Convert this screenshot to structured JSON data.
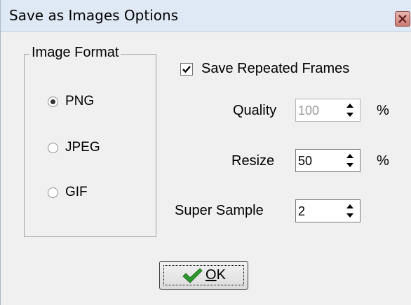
{
  "window": {
    "title": "Save as Images Options"
  },
  "image_format": {
    "label": "Image Format",
    "options": [
      "PNG",
      "JPEG",
      "GIF"
    ],
    "selected": "PNG"
  },
  "save_repeated_frames": {
    "label": "Save Repeated Frames",
    "checked": true
  },
  "quality": {
    "label": "Quality",
    "value": "100",
    "unit": "%",
    "enabled": false
  },
  "resize": {
    "label": "Resize",
    "value": "50",
    "unit": "%",
    "enabled": true
  },
  "super_sample": {
    "label": "Super Sample",
    "value": "2",
    "enabled": true
  },
  "ok_button": {
    "label_prefix": "",
    "label_underlined": "O",
    "label_rest": "K"
  },
  "colors": {
    "check_green": "#2f9a2f",
    "titlebar": "#dfe9f5",
    "dialog_bg": "#f0f0f0"
  },
  "icons": {
    "close": "close-x-icon",
    "ok": "checkmark-icon",
    "spin": "spin-arrows-icon"
  }
}
